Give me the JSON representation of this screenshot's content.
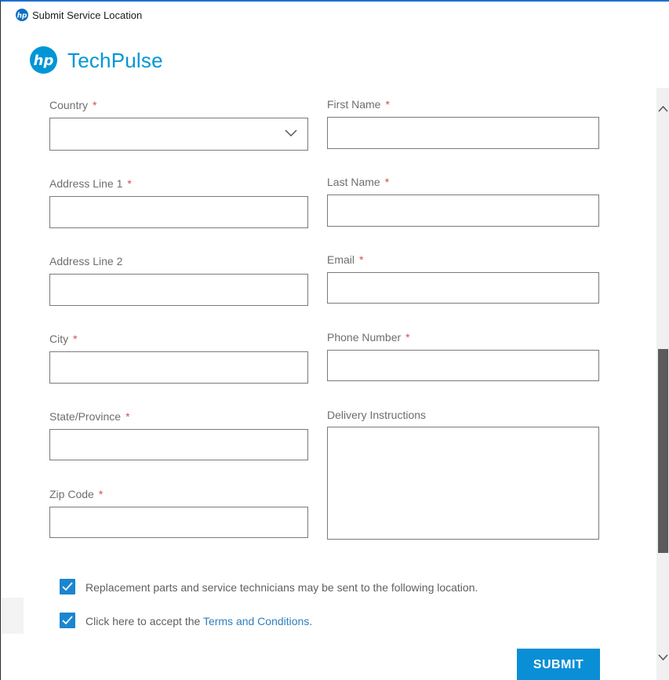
{
  "window": {
    "title": "Submit Service Location"
  },
  "brand": {
    "name": "TechPulse",
    "color": "#0096d6"
  },
  "form": {
    "country": {
      "label": "Country",
      "required": "*",
      "value": ""
    },
    "first_name": {
      "label": "First Name",
      "required": "*",
      "value": ""
    },
    "address_line_1": {
      "label": "Address Line 1",
      "required": "*",
      "value": ""
    },
    "last_name": {
      "label": "Last Name",
      "required": "*",
      "value": ""
    },
    "address_line_2": {
      "label": "Address Line 2",
      "value": ""
    },
    "email": {
      "label": "Email",
      "required": "*",
      "value": ""
    },
    "city": {
      "label": "City",
      "required": "*",
      "value": ""
    },
    "phone_number": {
      "label": "Phone Number",
      "required": "*",
      "value": ""
    },
    "state_province": {
      "label": "State/Province",
      "required": "*",
      "value": ""
    },
    "delivery_instructions": {
      "label": "Delivery Instructions",
      "value": ""
    },
    "zip_code": {
      "label": "Zip Code",
      "required": "*",
      "value": ""
    }
  },
  "checks": {
    "replacement": {
      "checked": true,
      "label": "Replacement parts and service technicians may be sent to the following location."
    },
    "terms": {
      "checked": true,
      "label_prefix": "Click here to accept the ",
      "link_text": "Terms and Conditions",
      "label_suffix": "."
    }
  },
  "actions": {
    "submit_label": "SUBMIT"
  },
  "icons": {
    "app_logo": "hp-logo-icon",
    "dropdown": "chevron-down-icon",
    "check": "check-icon",
    "scroll_up": "chevron-up-icon",
    "scroll_down": "chevron-down-icon"
  },
  "colors": {
    "accent": "#0a8fd6",
    "checkbox": "#1a86d0",
    "required": "#d05050",
    "link": "#2f7fbf"
  }
}
